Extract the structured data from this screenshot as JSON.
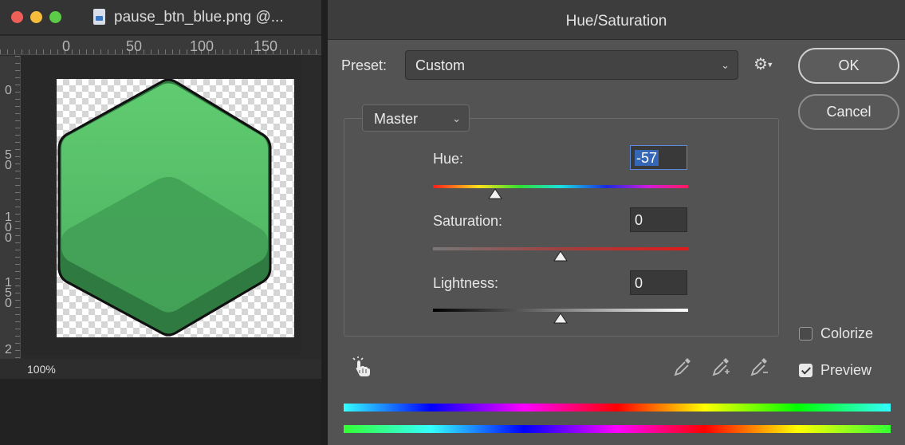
{
  "document_window": {
    "title": "pause_btn_blue.png @...",
    "ruler_top_labels": [
      "0",
      "50",
      "100",
      "150"
    ],
    "ruler_left_labels": [
      "0",
      "5\n0",
      "1\n0\n0",
      "1\n5\n0",
      "2"
    ],
    "zoom": "100%"
  },
  "dialog": {
    "title": "Hue/Saturation",
    "preset_label": "Preset:",
    "preset_value": "Custom",
    "channel_value": "Master",
    "hue": {
      "label": "Hue:",
      "value": "-57",
      "slider_fraction": 0.245
    },
    "saturation": {
      "label": "Saturation:",
      "value": "0",
      "slider_fraction": 0.5
    },
    "lightness": {
      "label": "Lightness:",
      "value": "0",
      "slider_fraction": 0.5
    },
    "ok_label": "OK",
    "cancel_label": "Cancel",
    "colorize": {
      "label": "Colorize",
      "checked": false
    },
    "preview": {
      "label": "Preview",
      "checked": true
    }
  },
  "colors": {
    "hex_fill_top": "#5cc56c",
    "hex_fill_bottom": "#3f9a52",
    "hex_outline": "#111111",
    "selection_blue": "#3667b6"
  }
}
